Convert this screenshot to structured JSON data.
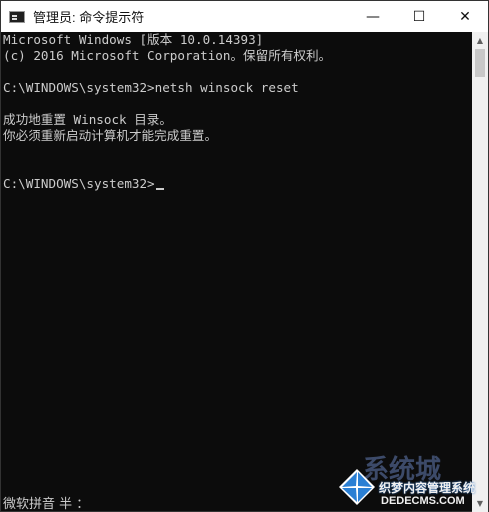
{
  "window": {
    "title": "管理员: 命令提示符",
    "controls": {
      "minimize": "—",
      "maximize": "☐",
      "close": "✕"
    }
  },
  "console": {
    "lines": [
      "Microsoft Windows [版本 10.0.14393]",
      "(c) 2016 Microsoft Corporation。保留所有权利。",
      "",
      "C:\\WINDOWS\\system32>netsh winsock reset",
      "",
      "成功地重置 Winsock 目录。",
      "你必须重新启动计算机才能完成重置。",
      "",
      "",
      "C:\\WINDOWS\\system32>"
    ]
  },
  "ime_status": "微软拼音 半 ：",
  "watermark": {
    "faint_text": "系统城",
    "line1": "织梦内容管理系统",
    "line2": "DEDECMS.COM"
  },
  "scrollbar": {
    "up_arrow": "▲",
    "down_arrow": "▼"
  }
}
